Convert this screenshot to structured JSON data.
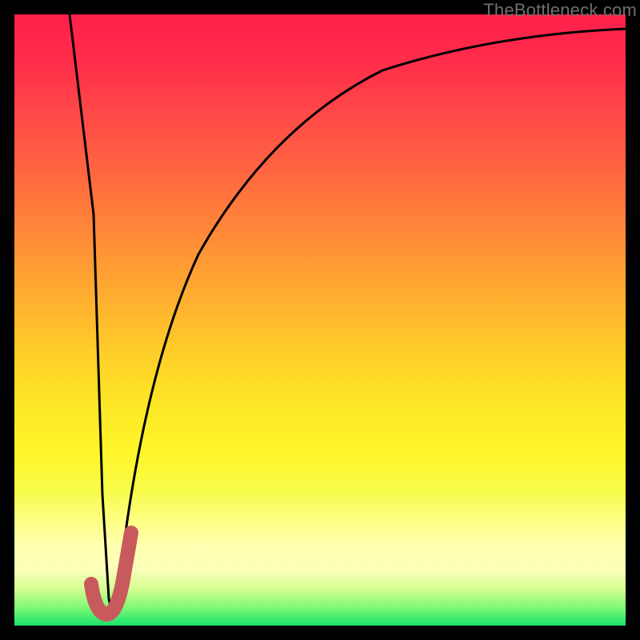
{
  "watermark": "TheBottleneck.com",
  "chart_data": {
    "type": "line",
    "title": "",
    "xlabel": "",
    "ylabel": "",
    "xlim": [
      0,
      100
    ],
    "ylim": [
      0,
      100
    ],
    "series": [
      {
        "name": "black-curve",
        "color": "#000000",
        "x": [
          9,
          11,
          13,
          14.5,
          15.5,
          17,
          19,
          22,
          26,
          32,
          40,
          50,
          62,
          78,
          100
        ],
        "y": [
          100,
          60,
          20,
          5,
          2,
          5,
          22,
          45,
          62,
          75,
          84,
          89,
          92,
          94,
          95
        ]
      },
      {
        "name": "red-check",
        "color": "#c85a5d",
        "x": [
          12.5,
          14,
          15.5,
          17.5,
          19
        ],
        "y": [
          6,
          2,
          1.5,
          8,
          16
        ]
      }
    ],
    "gradient_stops": [
      {
        "pos": 0.0,
        "color": "#ff1f4a"
      },
      {
        "pos": 0.36,
        "color": "#ff8a38"
      },
      {
        "pos": 0.72,
        "color": "#fff62a"
      },
      {
        "pos": 0.87,
        "color": "#ffffb0"
      },
      {
        "pos": 1.0,
        "color": "#17e36a"
      }
    ]
  }
}
